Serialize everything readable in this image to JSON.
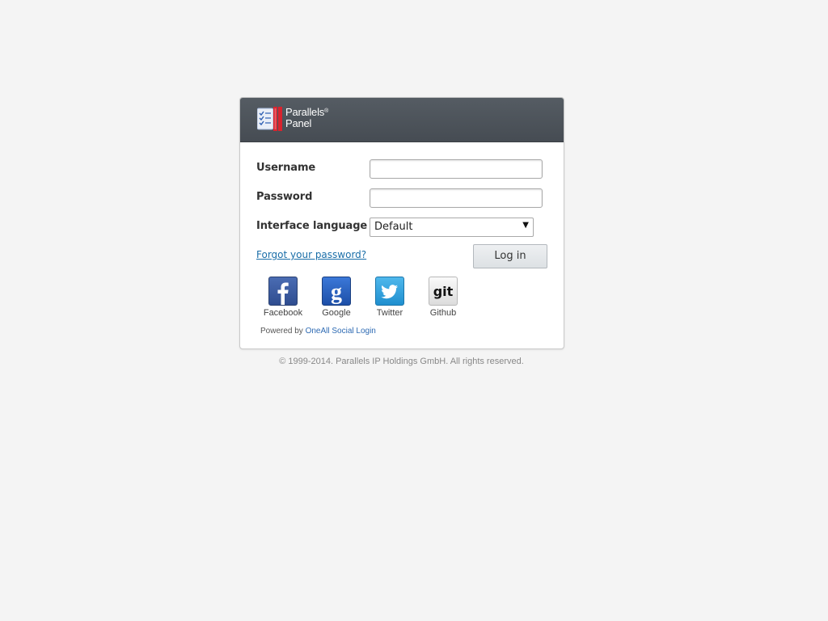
{
  "header": {
    "logo_line1": "Parallels",
    "logo_reg": "®",
    "logo_line2": "Panel"
  },
  "form": {
    "username_label": "Username",
    "username_value": "",
    "password_label": "Password",
    "password_value": "",
    "language_label": "Interface language",
    "language_selected": "Default",
    "forgot_link": "Forgot your password?",
    "login_button": "Log in"
  },
  "social": {
    "items": [
      {
        "label": "Facebook",
        "icon": "facebook-icon",
        "color": "#3b5998"
      },
      {
        "label": "Google",
        "icon": "google-icon",
        "color": "#2a64c5"
      },
      {
        "label": "Twitter",
        "icon": "twitter-icon",
        "color": "#2aa3e0"
      },
      {
        "label": "Github",
        "icon": "github-icon",
        "color": "#e8e8e8"
      }
    ],
    "powered_prefix": "Powered by",
    "powered_link": "OneAll Social Login"
  },
  "footer": {
    "copyright": "© 1999-2014. Parallels IP Holdings GmbH. All rights reserved."
  },
  "colors": {
    "header_bg": "#4b5157",
    "link": "#1a6ea8",
    "page_bg": "#f4f4f4"
  }
}
